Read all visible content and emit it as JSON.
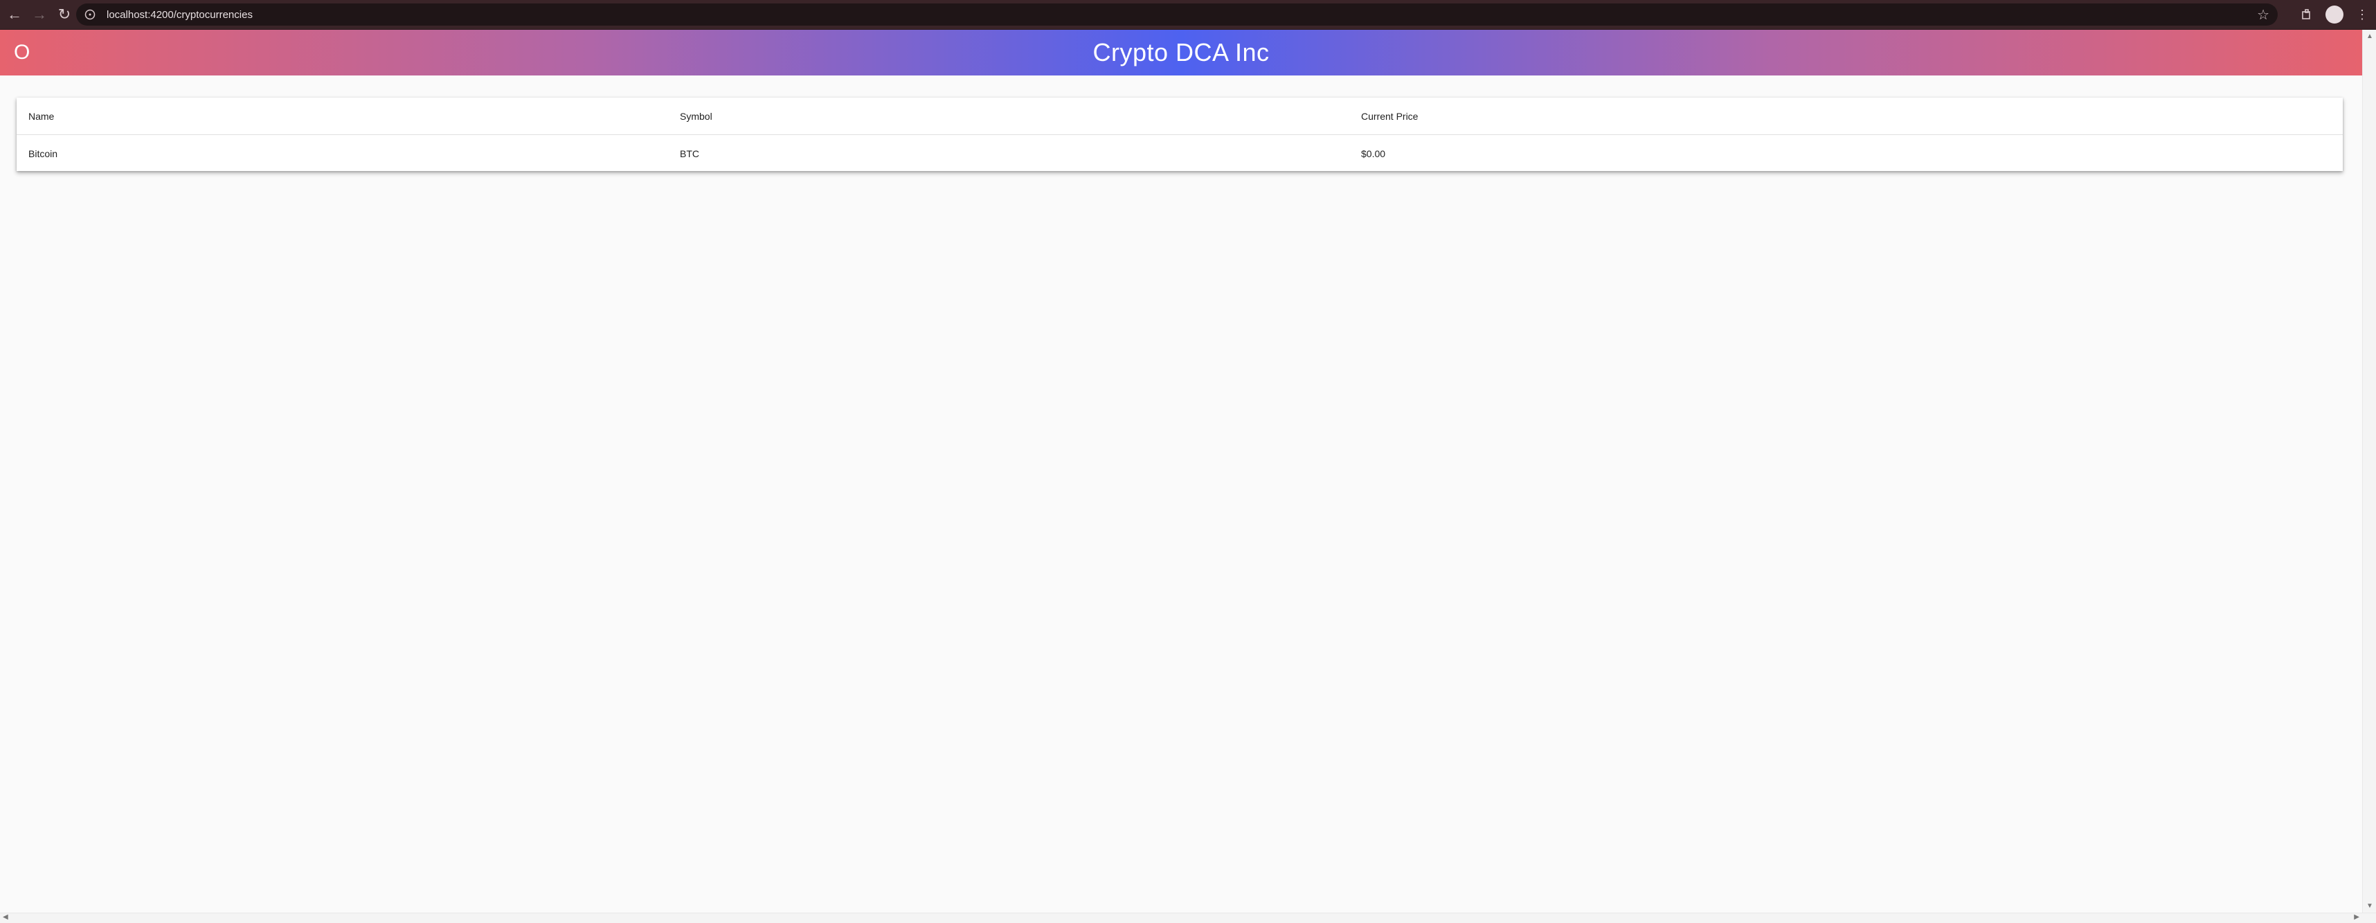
{
  "browser": {
    "url": "localhost:4200/cryptocurrencies"
  },
  "header": {
    "left_text": "Open",
    "title": "Crypto DCA Inc"
  },
  "table": {
    "columns": [
      "Name",
      "Symbol",
      "Current Price"
    ],
    "rows": [
      [
        "Bitcoin",
        "BTC",
        "$0.00"
      ]
    ]
  },
  "colors": {
    "header_gradient_edge": "#e6636e",
    "header_gradient_center": "#4e62f0",
    "page_background": "#fafafa"
  }
}
